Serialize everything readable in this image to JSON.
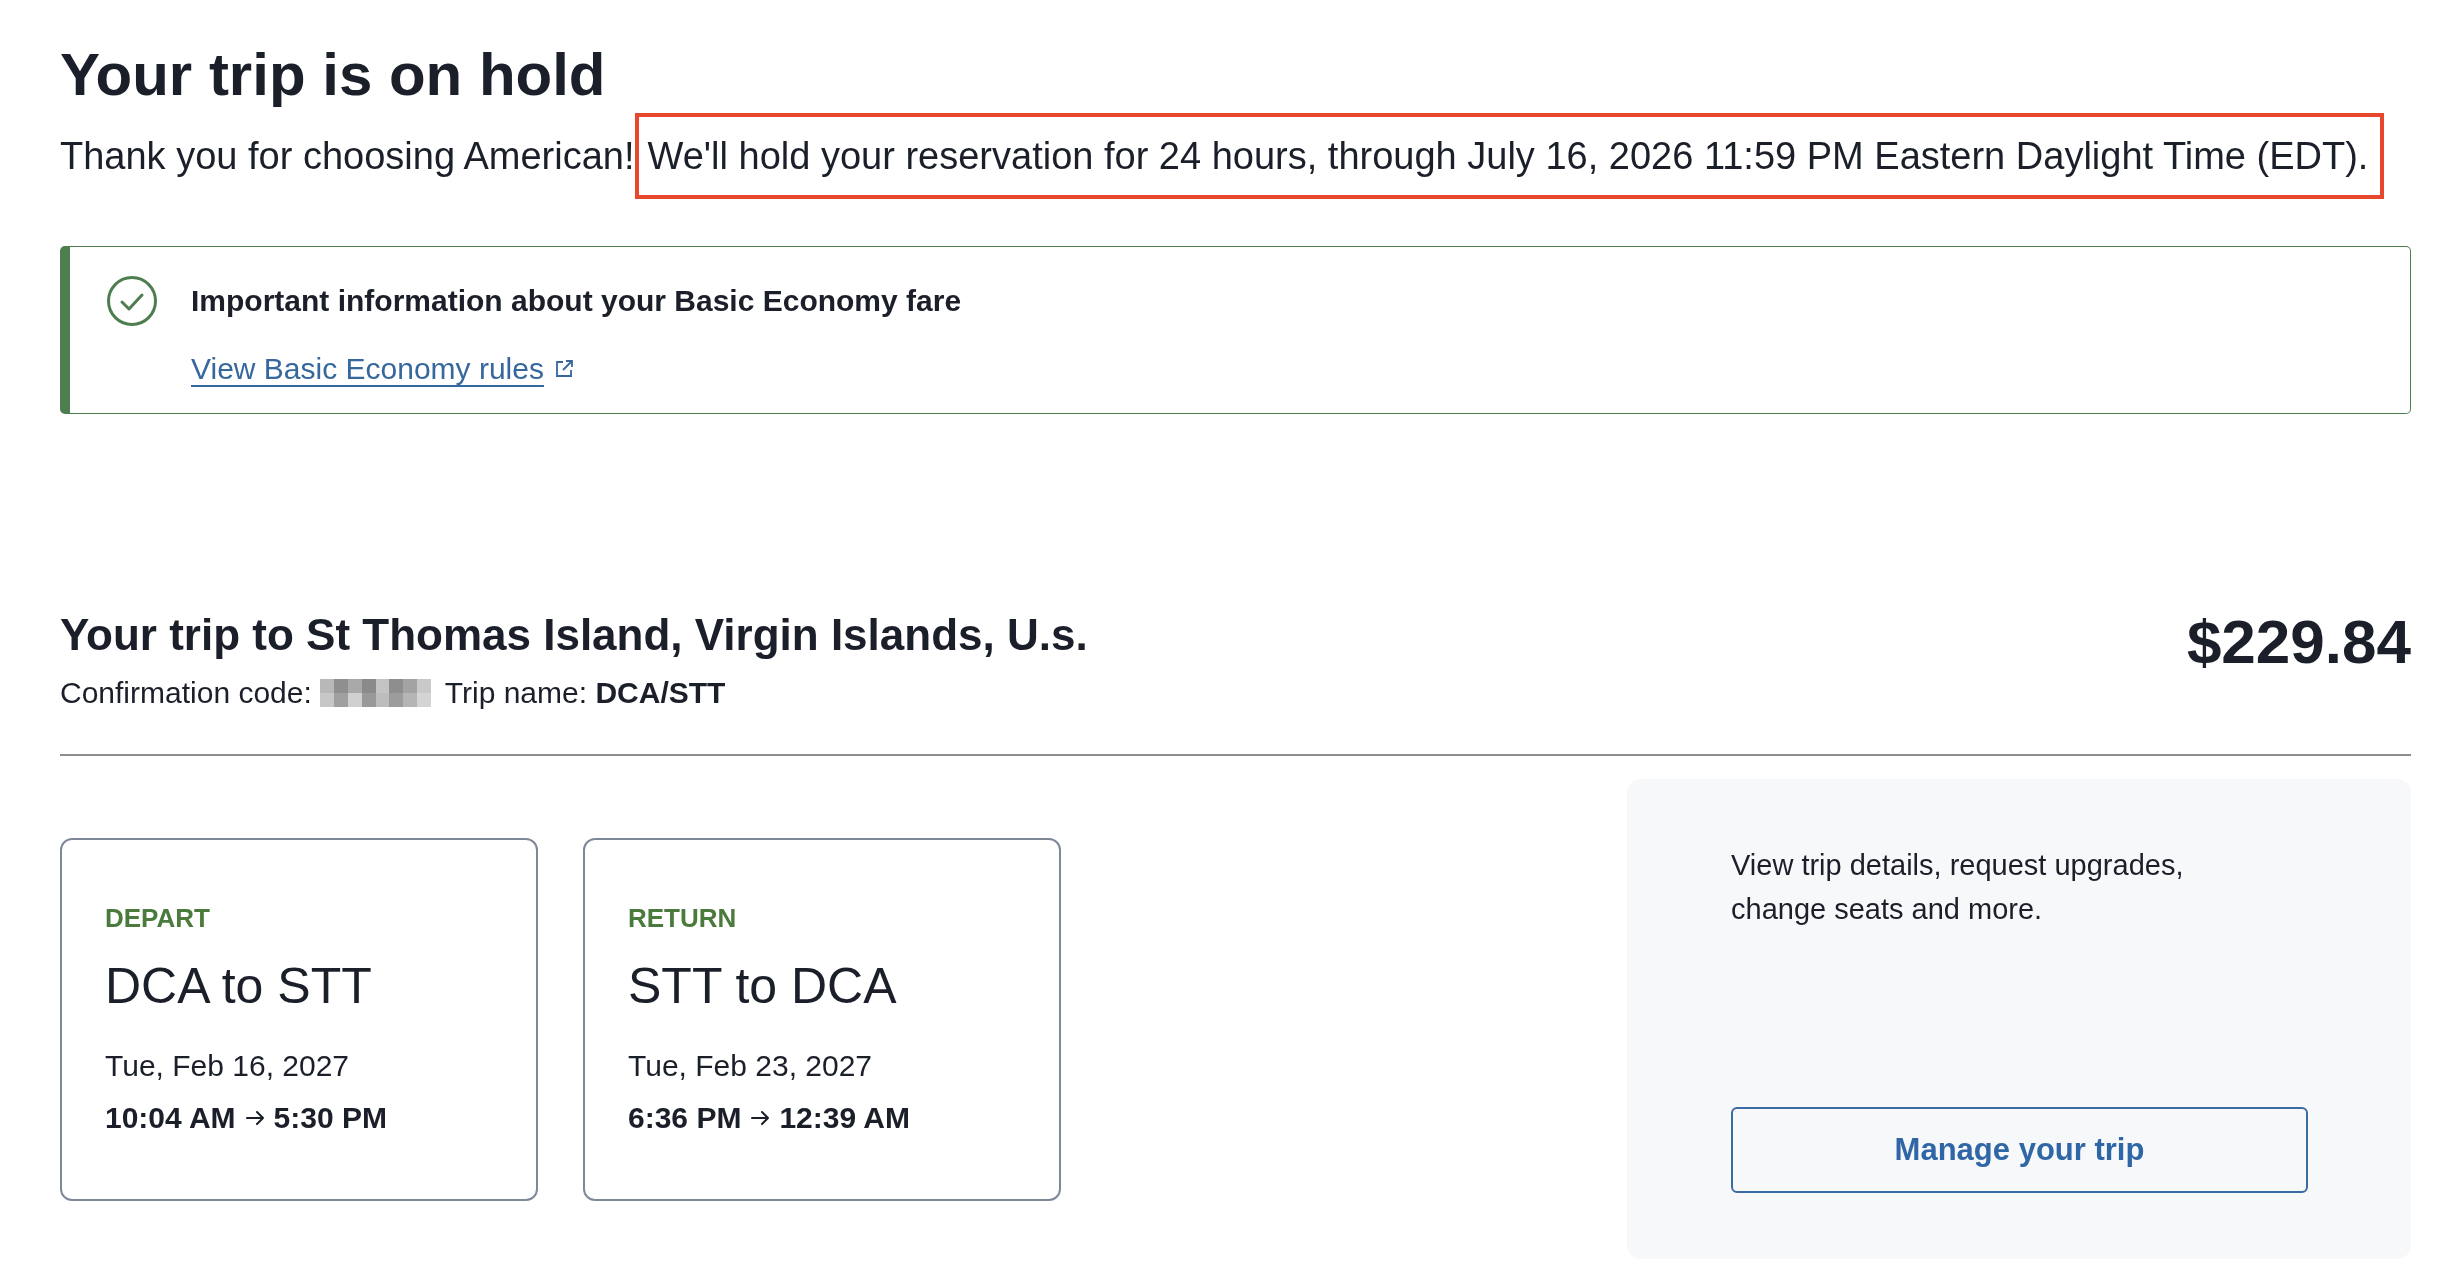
{
  "page": {
    "title": "Your trip is on hold"
  },
  "intro": {
    "text": "Thank you for choosing American!"
  },
  "hold_notice": {
    "text": "We'll hold your reservation for 24 hours, through July 16, 2026 11:59 PM Eastern Daylight Time (EDT).",
    "highlighted": true
  },
  "alert": {
    "kind": "success",
    "title": "Important information about your Basic Economy fare",
    "link": "View Basic Economy rules"
  },
  "trip": {
    "title": "Your trip to St Thomas Island, Virgin Islands, U.s.",
    "price": "$229.84",
    "confirmation_label": "Confirmation code:",
    "trip_name": "Trip name: **DCA/STT**"
  },
  "flights": [
    {
      "label": "DEPART",
      "route": "DCA to STT",
      "date": "Tue, Feb 16, 2027",
      "departure_time": "10:04 AM",
      "arrival_time": "5:30 PM"
    },
    {
      "label": "RETURN",
      "route": "STT to DCA",
      "date": "Tue, Feb 23, 2027",
      "departure_time": "6:36 PM",
      "arrival_time": "12:39 AM"
    }
  ],
  "manage_panel": {
    "text": "View trip details, request upgrades, change seats and more.",
    "button": "Manage your trip"
  }
}
